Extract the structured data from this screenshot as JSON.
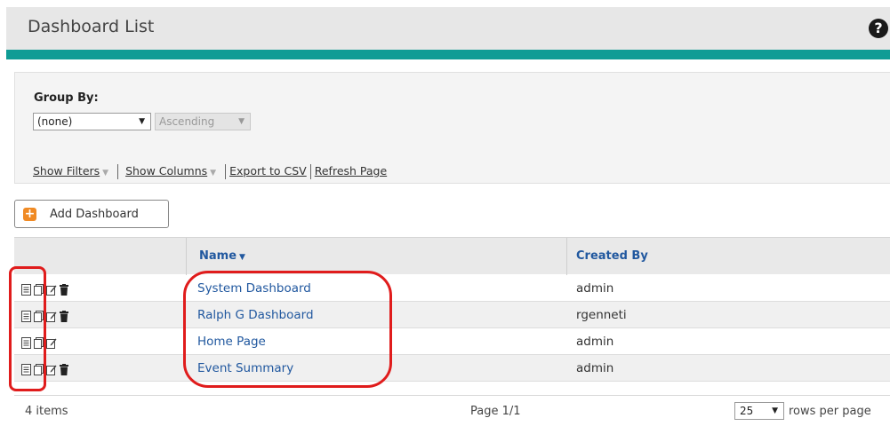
{
  "header": {
    "title": "Dashboard List",
    "help_icon": "help-icon"
  },
  "colors": {
    "accent_bar": "#0f9c95",
    "link": "#21589f",
    "add_button_icon": "#f08a24",
    "annotation": "#e01c1c"
  },
  "options": {
    "group_by_label": "Group By:",
    "group_by_value": "(none)",
    "sort_value": "Ascending",
    "links": {
      "show_filters": "Show Filters",
      "show_columns": "Show Columns",
      "export_csv": "Export to CSV",
      "refresh_page": "Refresh Page"
    }
  },
  "add_button": {
    "label": "Add Dashboard",
    "icon": "plus-icon"
  },
  "table": {
    "columns": {
      "name": "Name",
      "created_by": "Created By"
    },
    "row_icons": [
      "view-icon",
      "copy-icon",
      "edit-icon",
      "delete-icon"
    ],
    "rows": [
      {
        "name": "System Dashboard",
        "created_by": "admin",
        "deletable": true
      },
      {
        "name": "Ralph G Dashboard",
        "created_by": "rgenneti",
        "deletable": true
      },
      {
        "name": "Home Page",
        "created_by": "admin",
        "deletable": false
      },
      {
        "name": "Event Summary",
        "created_by": "admin",
        "deletable": true
      }
    ]
  },
  "footer": {
    "count": "4 items",
    "page": "Page 1/1",
    "rows_per_page_value": "25",
    "rows_per_page_label": "rows per page"
  }
}
